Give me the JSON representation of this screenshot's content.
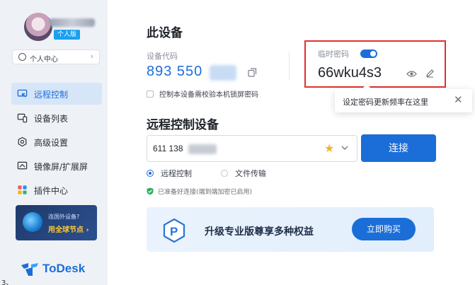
{
  "sidebar": {
    "badge": "个人版",
    "personal_center": "个人中心",
    "items": [
      {
        "label": "远程控制",
        "icon": "remote-control-icon"
      },
      {
        "label": "设备列表",
        "icon": "device-list-icon"
      },
      {
        "label": "高级设置",
        "icon": "settings-icon"
      },
      {
        "label": "镜像屏/扩展屏",
        "icon": "mirror-screen-icon"
      },
      {
        "label": "插件中心",
        "icon": "plugin-icon"
      }
    ],
    "promo": {
      "line1": "连国外设备?",
      "line2": "用全球节点 ›"
    },
    "logo": "ToDesk",
    "edge_char": "3、"
  },
  "device": {
    "title": "此设备",
    "code_label": "设备代码",
    "code_value": "893 550",
    "lock_check": "控制本设备需校验本机锁屏密码",
    "temp_label": "临时密码",
    "temp_toggle_on": true,
    "temp_value": "66wku4s3"
  },
  "tooltip": {
    "text": "设定密码更新频率在这里"
  },
  "remote": {
    "title": "远程控制设备",
    "device_id": "611 138",
    "connect": "连接",
    "mode_options": [
      "远程控制",
      "文件传输"
    ],
    "mode_selected": "远程控制",
    "ready": "已准备好连接(端到端加密已启用)"
  },
  "banner": {
    "text": "升级专业版尊享多种权益",
    "button": "立即购买"
  },
  "colors": {
    "accent": "#1b6ed8",
    "highlight": "#e03030",
    "star": "#f3b320"
  }
}
